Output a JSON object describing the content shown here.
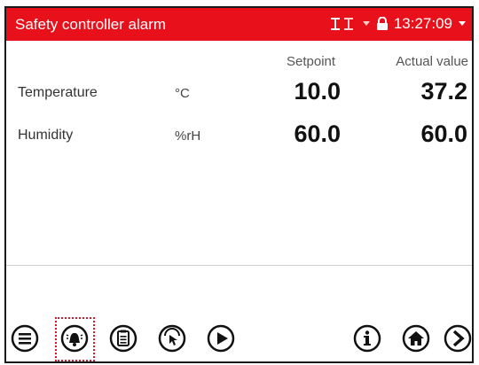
{
  "window": {
    "title": "Safety controller alarm",
    "time": "13:27:09"
  },
  "columns": {
    "setpoint": "Setpoint",
    "actual": "Actual value"
  },
  "rows": [
    {
      "label": "Temperature",
      "unit": "°C",
      "setpoint": "10.0",
      "actual": "37.2"
    },
    {
      "label": "Humidity",
      "unit": "%rH",
      "setpoint": "60.0",
      "actual": "60.0"
    }
  ],
  "colors": {
    "titlebar": "#e8101a",
    "alarm_highlight": "#d21a2a"
  },
  "toolbar": {
    "buttons": [
      "menu-icon",
      "alarm-bell-icon",
      "clipboard-icon",
      "program-icon",
      "play-icon",
      "info-icon",
      "home-icon",
      "next-icon"
    ]
  }
}
